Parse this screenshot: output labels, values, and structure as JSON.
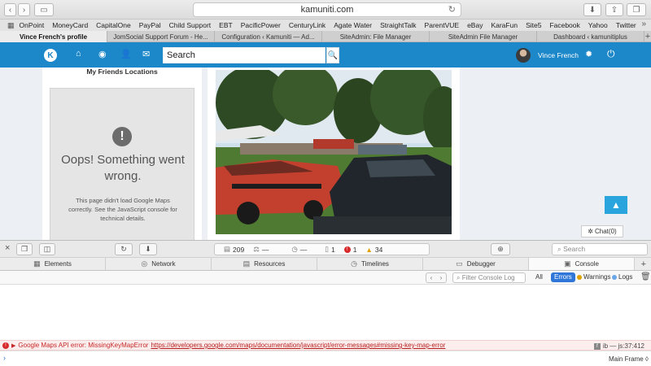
{
  "browser": {
    "url": "kamuniti.com",
    "bookmarks": [
      "OnPoint",
      "MoneyCard",
      "CapitalOne",
      "PayPal",
      "Child Support",
      "EBT",
      "PacificPower",
      "CenturyLink",
      "Agate Water",
      "StraightTalk",
      "ParentVUE",
      "eBay",
      "KaraFun",
      "Site5",
      "Facebook",
      "Yahoo",
      "Twitter"
    ],
    "tabs": [
      {
        "label": "Vince French's profile",
        "active": true
      },
      {
        "label": "JomSocial Support Forum - He...",
        "active": false
      },
      {
        "label": "Configuration ‹ Kamuniti — Ad...",
        "active": false
      },
      {
        "label": "SiteAdmin: File Manager",
        "active": false
      },
      {
        "label": "SiteAdmin File Manager",
        "active": false
      },
      {
        "label": "Dashboard ‹ kamunitiplus",
        "active": false
      }
    ]
  },
  "site": {
    "search_placeholder": "Search",
    "username": "Vince French",
    "brand_color": "#1c87c9"
  },
  "friends_map": {
    "title": "My Friends Locations",
    "error_title": "Oops! Something went wrong.",
    "error_body": "This page didn't load Google Maps correctly. See the JavaScript console for technical details."
  },
  "chat": {
    "label": "Chat(0)"
  },
  "inspector": {
    "stats": {
      "resources": "209",
      "size": "—",
      "time": "—",
      "logs": "1",
      "errors": "1",
      "warnings": "34"
    },
    "search_placeholder": "Search",
    "tabs": [
      "Elements",
      "Network",
      "Resources",
      "Timelines",
      "Debugger",
      "Console"
    ],
    "active_tab": "Console",
    "console": {
      "filter_placeholder": "Filter Console Log",
      "filters": [
        "All",
        "Errors",
        "Warnings",
        "Logs"
      ],
      "active_filter": "Errors",
      "error": {
        "message": "Google Maps API error: MissingKeyMapError",
        "url": "https://developers.google.com/maps/documentation/javascript/error-messages#missing-key-map-error",
        "source": "ib — js:37:412"
      },
      "frame": "Main Frame ◊"
    }
  }
}
